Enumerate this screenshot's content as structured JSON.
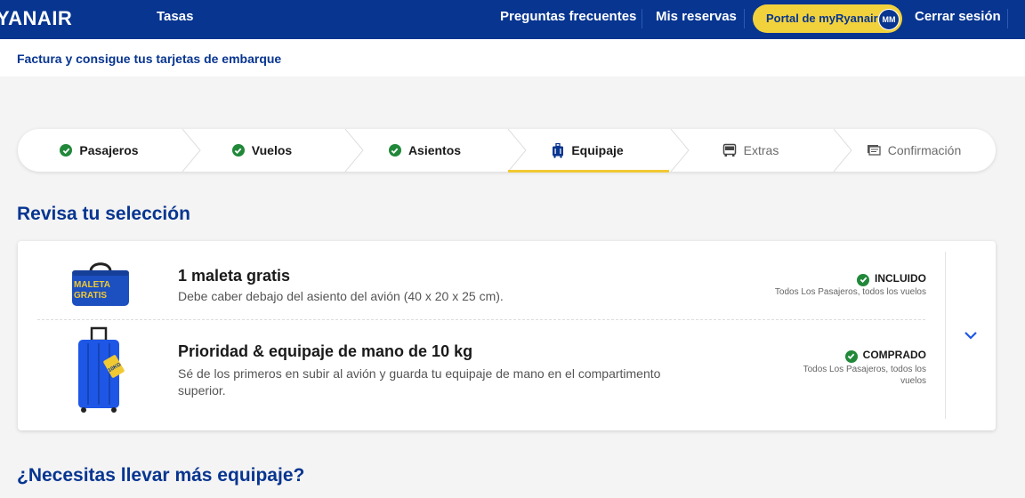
{
  "header": {
    "brand": "YANAIR",
    "fees": "Tasas",
    "faq": "Preguntas frecuentes",
    "bookings": "Mis reservas",
    "portal": "Portal de myRyanair",
    "avatar": "MM",
    "logout": "Cerrar sesión"
  },
  "subheader": {
    "title": "Factura y consigue tus tarjetas de embarque"
  },
  "steps": [
    {
      "label": "Pasajeros",
      "state": "done",
      "icon": "check-icon"
    },
    {
      "label": "Vuelos",
      "state": "done",
      "icon": "check-icon"
    },
    {
      "label": "Asientos",
      "state": "done",
      "icon": "check-icon"
    },
    {
      "label": "Equipaje",
      "state": "active",
      "icon": "luggage-icon"
    },
    {
      "label": "Extras",
      "state": "todo",
      "icon": "bus-icon"
    },
    {
      "label": "Confirmación",
      "state": "todo",
      "icon": "tickets-icon"
    }
  ],
  "review": {
    "heading": "Revisa tu selección",
    "items": [
      {
        "title": "1 maleta gratis",
        "description": "Debe caber debajo del asiento del avión (40 x 20 x 25 cm).",
        "status": "INCLUIDO",
        "scope": "Todos Los Pasajeros, todos los vuelos",
        "bag_text": [
          "MALETA",
          "GRATIS"
        ]
      },
      {
        "title": "Prioridad & equipaje de mano de 10 kg",
        "description_line1": "Sé de los primeros en subir al avión y guarda tu equipaje de mano en el compartimento",
        "description_line2": "superior.",
        "status": "COMPRADO",
        "scope_line1": "Todos Los Pasajeros, todos los",
        "scope_line2": "vuelos",
        "tag_text": "10KG"
      }
    ]
  },
  "more": {
    "heading": "¿Necesitas llevar más equipaje?"
  },
  "colors": {
    "brand_blue": "#073590",
    "accent_yellow": "#f1c933",
    "success_green": "#21883a"
  }
}
